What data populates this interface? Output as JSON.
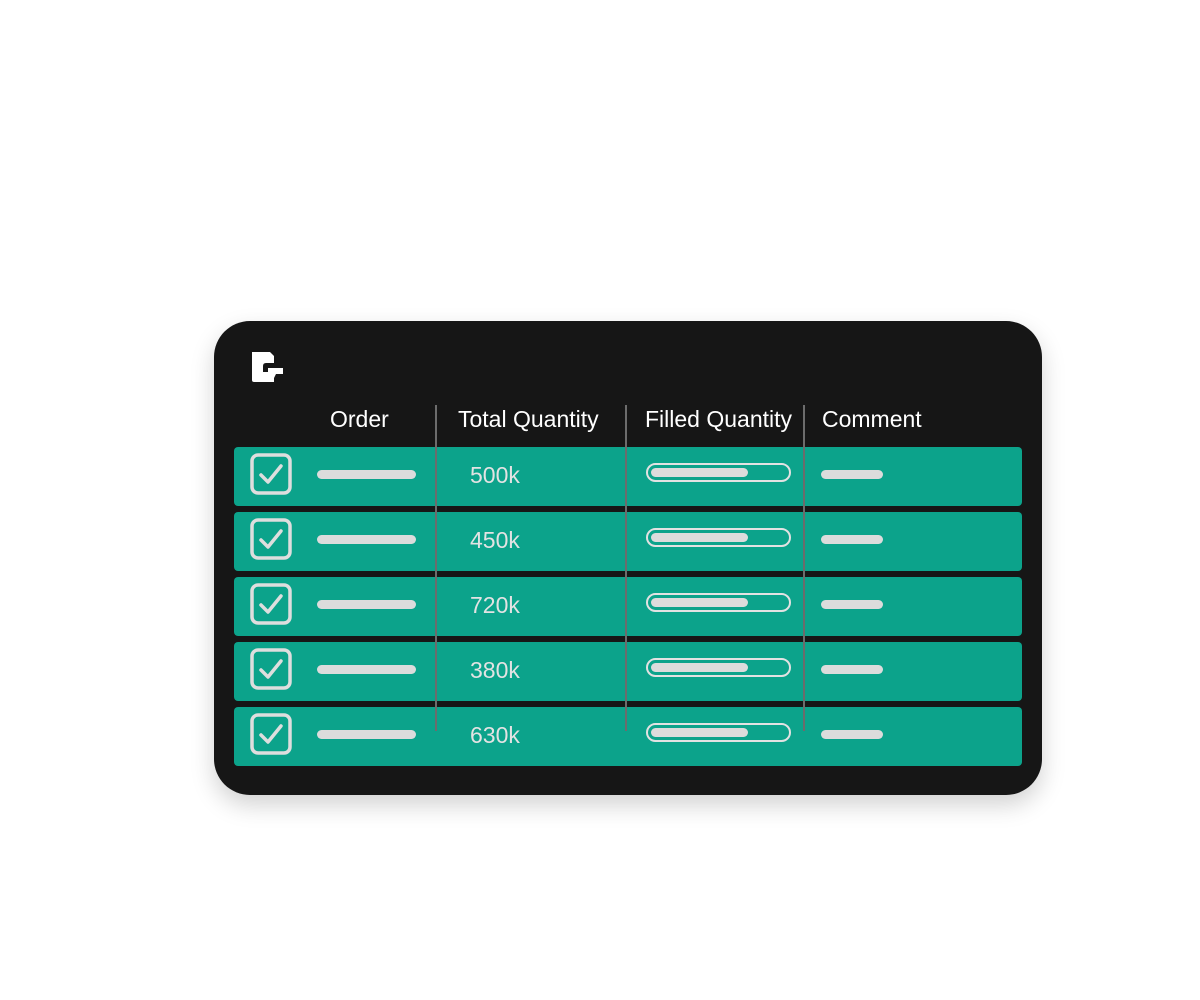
{
  "table": {
    "columns": {
      "order": "Order",
      "total_quantity": "Total Quantity",
      "filled_quantity": "Filled Quantity",
      "comment": "Comment"
    },
    "rows": [
      {
        "checked": true,
        "total_quantity": "500k",
        "filled_fraction": 0.72
      },
      {
        "checked": true,
        "total_quantity": "450k",
        "filled_fraction": 0.72
      },
      {
        "checked": true,
        "total_quantity": "720k",
        "filled_fraction": 0.72
      },
      {
        "checked": true,
        "total_quantity": "380k",
        "filled_fraction": 0.72
      },
      {
        "checked": true,
        "total_quantity": "630k",
        "filled_fraction": 0.72
      }
    ]
  },
  "colors": {
    "card_background": "#161616",
    "row_background": "#0ca38b",
    "placeholder_bar": "#dcdcdc",
    "divider": "#6c6c6c"
  },
  "icons": {
    "logo": "app-logo-icon",
    "checkbox": "checkbox-checked-icon"
  }
}
